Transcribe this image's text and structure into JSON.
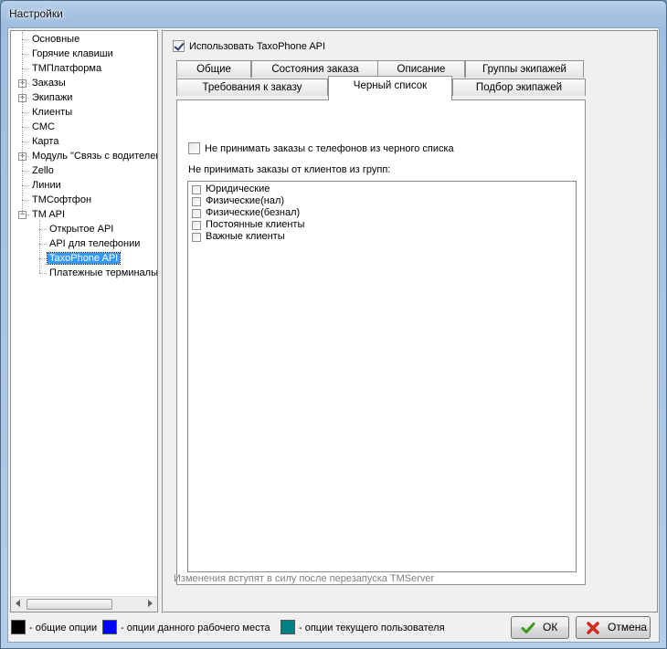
{
  "window": {
    "title": "Настройки"
  },
  "tree": {
    "items": [
      {
        "label": "Основные",
        "level": 0,
        "expander": ""
      },
      {
        "label": "Горячие клавиши",
        "level": 0,
        "expander": ""
      },
      {
        "label": "ТМПлатформа",
        "level": 0,
        "expander": ""
      },
      {
        "label": "Заказы",
        "level": 0,
        "expander": "+"
      },
      {
        "label": "Экипажи",
        "level": 0,
        "expander": "+"
      },
      {
        "label": "Клиенты",
        "level": 0,
        "expander": ""
      },
      {
        "label": "СМС",
        "level": 0,
        "expander": ""
      },
      {
        "label": "Карта",
        "level": 0,
        "expander": ""
      },
      {
        "label": "Модуль \"Связь с водителем\"",
        "level": 0,
        "expander": "+"
      },
      {
        "label": "Zello",
        "level": 0,
        "expander": ""
      },
      {
        "label": "Линии",
        "level": 0,
        "expander": ""
      },
      {
        "label": "ТМСофтфон",
        "level": 0,
        "expander": ""
      },
      {
        "label": "TM API",
        "level": 0,
        "expander": "-"
      },
      {
        "label": "Открытое API",
        "level": 1,
        "expander": ""
      },
      {
        "label": "API для телефонии",
        "level": 1,
        "expander": ""
      },
      {
        "label": "TaxoPhone API",
        "level": 1,
        "expander": "",
        "selected": true
      },
      {
        "label": "Платежные терминалы",
        "level": 1,
        "expander": ""
      }
    ]
  },
  "main": {
    "use_api_label": "Использовать TaxoPhone API",
    "use_api_checked": true,
    "tabs_row1": [
      "Общие",
      "Состояния заказа",
      "Описание",
      "Группы экипажей"
    ],
    "tabs_row2": [
      "Требования к заказу",
      "Черный список",
      "Подбор экипажей"
    ],
    "active_tab": "Черный список",
    "blacklist_phone_label": "Не принимать заказы с телефонов из черного списка",
    "groups_label": "Не принимать заказы от клиентов из групп:",
    "groups": [
      "Юридические",
      "Физические(нал)",
      "Физические(безнал)",
      "Постоянные клиенты",
      "Важные клиенты"
    ],
    "note": "Изменения вступят в силу после перезапуска TMServer"
  },
  "legend": {
    "general": {
      "label": "- общие опции",
      "color": "#000000"
    },
    "workplace": {
      "label": "- опции данного рабочего места",
      "color": "#0000ff"
    },
    "user": {
      "label": "- опции текущего пользователя",
      "color": "#008080"
    }
  },
  "buttons": {
    "ok": "ОК",
    "cancel": "Отмена"
  },
  "icons": {
    "ok": "checkmark-icon",
    "cancel": "cross-icon",
    "expand": "plus-box-icon",
    "collapse": "minus-box-icon"
  }
}
